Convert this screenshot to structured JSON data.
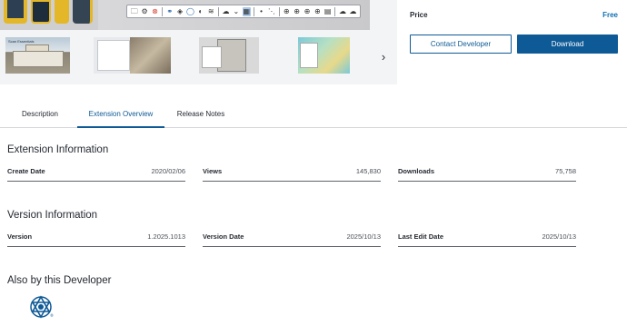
{
  "price": {
    "label": "Price",
    "value": "Free"
  },
  "buttons": {
    "contact": "Contact Developer",
    "download": "Download"
  },
  "gallery": {
    "thumb1_caption": "Scan Essentials"
  },
  "tabs": [
    {
      "label": "Description"
    },
    {
      "label": "Extension Overview"
    },
    {
      "label": "Release Notes"
    }
  ],
  "extension_info": {
    "title": "Extension Information",
    "fields": [
      {
        "label": "Create Date",
        "value": "2020/02/06"
      },
      {
        "label": "Views",
        "value": "145,830"
      },
      {
        "label": "Downloads",
        "value": "75,758"
      }
    ]
  },
  "version_info": {
    "title": "Version Information",
    "fields": [
      {
        "label": "Version",
        "value": "1.2025.1013"
      },
      {
        "label": "Version Date",
        "value": "2025/10/13"
      },
      {
        "label": "Last Edit Date",
        "value": "2025/10/13"
      }
    ]
  },
  "also_by": {
    "title": "Also by this Developer"
  },
  "colors": {
    "accent": "#0e5a96",
    "price": "#0e6fb1",
    "text": "#252a31"
  }
}
